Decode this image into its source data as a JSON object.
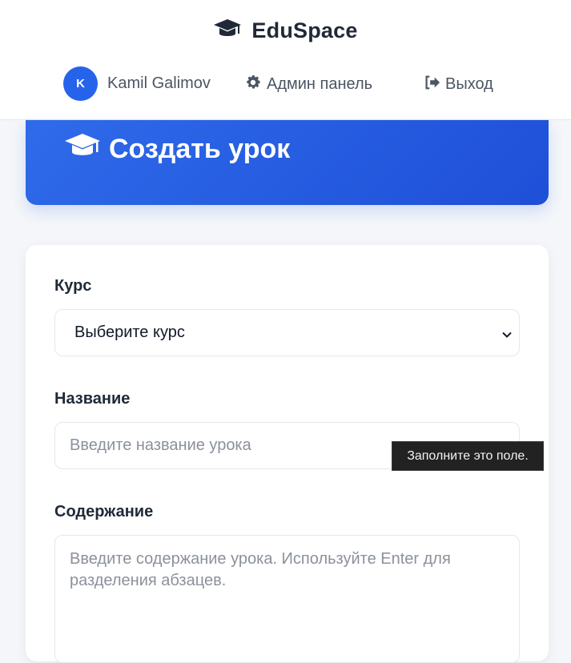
{
  "brand": {
    "name": "EduSpace",
    "icon": "graduation-cap-icon"
  },
  "nav": {
    "user_initial": "K",
    "user_name": "Kamil Galimov",
    "admin_label": "Админ панель",
    "admin_icon": "gear-icon",
    "logout_label": "Выход",
    "logout_icon": "sign-out-icon"
  },
  "hero": {
    "title": "Создать урок",
    "icon": "graduation-cap-icon"
  },
  "form": {
    "course_label": "Курс",
    "course_selected": "Выберите курс",
    "title_label": "Название",
    "title_placeholder": "Введите название урока",
    "title_value": "",
    "content_label": "Содержание",
    "content_placeholder": "Введите содержание урока. Используйте Enter для разделения абзацев.",
    "content_value": ""
  },
  "tooltip": {
    "text": "Заполните это поле."
  },
  "colors": {
    "accent": "#2563eb",
    "hero_gradient_start": "#2f6bea",
    "hero_gradient_end": "#1e4fd8",
    "text_dark": "#1f2937",
    "text_muted": "#4b5563"
  }
}
